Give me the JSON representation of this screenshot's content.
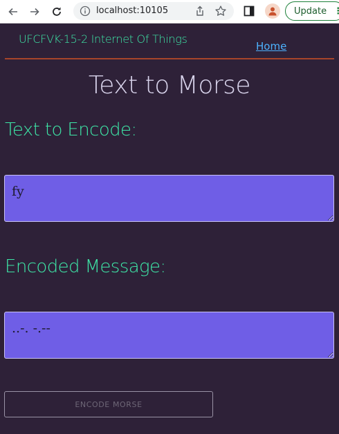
{
  "browser": {
    "url": "localhost:10105",
    "update_label": "Update"
  },
  "site": {
    "title": "UFCFVK-15-2 Internet Of Things",
    "nav_home": "Home"
  },
  "main": {
    "heading": "Text to Morse",
    "input_label": "Text to Encode:",
    "input_value": "fy",
    "output_label": "Encoded Message:",
    "output_value": "..-. -.--",
    "encode_button": "ENCODE MORSE"
  },
  "colors": {
    "background": "#2e2138",
    "accent_green": "#3ee8a8",
    "textbox_fill": "#6f5ee6",
    "divider": "#a8452a",
    "link": "#4db3ff"
  }
}
